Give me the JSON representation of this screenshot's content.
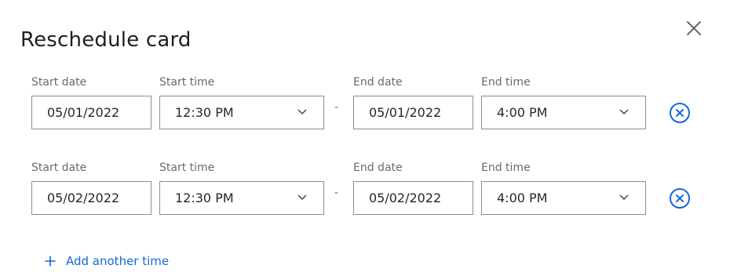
{
  "dialog": {
    "title": "Reschedule card"
  },
  "rows": [
    {
      "start_date_label": "Start date",
      "start_time_label": "Start time",
      "end_date_label": "End date",
      "end_time_label": "End time",
      "start_date": "05/01/2022",
      "start_time": "12:30 PM",
      "separator": "-",
      "end_date": "05/01/2022",
      "end_time": "4:00 PM"
    },
    {
      "start_date_label": "Start date",
      "start_time_label": "Start time",
      "end_date_label": "End date",
      "end_time_label": "End time",
      "start_date": "05/02/2022",
      "start_time": "12:30 PM",
      "separator": "-",
      "end_date": "05/02/2022",
      "end_time": "4:00 PM"
    }
  ],
  "add_time": {
    "label": "Add another time",
    "icon": "plus-icon"
  },
  "icons": {
    "close": "close-icon",
    "remove": "remove-circle-x-icon",
    "dropdown": "chevron-down-icon"
  },
  "colors": {
    "accent": "#1668d6",
    "border": "#8d8d8d",
    "label": "#6a6a6a"
  }
}
